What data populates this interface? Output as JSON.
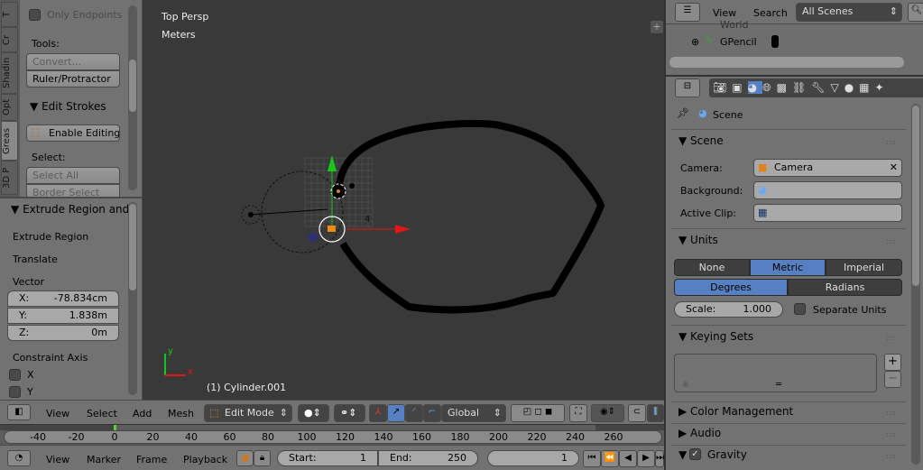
{
  "toolshelf": {
    "tabs": [
      "T",
      "Cr",
      "Shadin",
      "Opt",
      "Greas",
      "3D P"
    ],
    "only_endpoints": "Only Endpoints",
    "tools_label": "Tools:",
    "convert": "Convert...",
    "ruler": "Ruler/Protractor",
    "edit_strokes": "Edit Strokes",
    "enable_editing": "Enable Editing",
    "select_label": "Select:",
    "select_all": "Select All",
    "border_select": "Border Select"
  },
  "operator": {
    "title": "Extrude Region and",
    "extrude_region": "Extrude Region",
    "translate": "Translate",
    "vector_label": "Vector",
    "x_label": "X:",
    "x_value": "-78.834cm",
    "y_label": "Y:",
    "y_value": "1.838m",
    "z_label": "Z:",
    "z_value": "0m",
    "constraint_axis": "Constraint Axis",
    "axis_x": "X",
    "axis_y": "Y"
  },
  "viewport": {
    "view_name": "Top Persp",
    "units": "Meters",
    "object_info": "(1) Cylinder.001",
    "axis_x": "x",
    "axis_y": "y",
    "grid_number": "4",
    "colors": {
      "bg": "#393939",
      "x_axis": "#e01818",
      "y_axis": "#18c818",
      "stroke": "#000000"
    }
  },
  "view3d_header": {
    "menus": [
      "View",
      "Select",
      "Add",
      "Mesh"
    ],
    "mode": "Edit Mode",
    "orientation": "Global"
  },
  "timeline": {
    "ticks": [
      "-40",
      "-20",
      "0",
      "20",
      "40",
      "60",
      "80",
      "100",
      "120",
      "140",
      "160",
      "180",
      "200",
      "220",
      "240",
      "260"
    ],
    "current_frame_marker_color": "#5fcf3f",
    "menus": [
      "View",
      "Marker",
      "Frame",
      "Playback"
    ],
    "start_label": "Start:",
    "start_value": "1",
    "end_label": "End:",
    "end_value": "250",
    "current_frame": "1"
  },
  "outliner": {
    "menus": [
      "View",
      "Search"
    ],
    "filter": "All Scenes",
    "items": [
      "World",
      "GPencil"
    ]
  },
  "properties": {
    "breadcrumb": "Scene",
    "scene_section": "Scene",
    "camera_label": "Camera:",
    "camera_value": "Camera",
    "background_label": "Background:",
    "active_clip_label": "Active Clip:",
    "units_section": "Units",
    "unit_systems": [
      "None",
      "Metric",
      "Imperial"
    ],
    "unit_system_selected": "Metric",
    "rotation_units": [
      "Degrees",
      "Radians"
    ],
    "rotation_selected": "Degrees",
    "scale_label": "Scale:",
    "scale_value": "1.000",
    "separate_units": "Separate Units",
    "keying_sets_section": "Keying Sets",
    "color_management_section": "Color Management",
    "audio_section": "Audio",
    "gravity_section": "Gravity",
    "gravity_enabled": true,
    "accent": "#5680c2"
  }
}
